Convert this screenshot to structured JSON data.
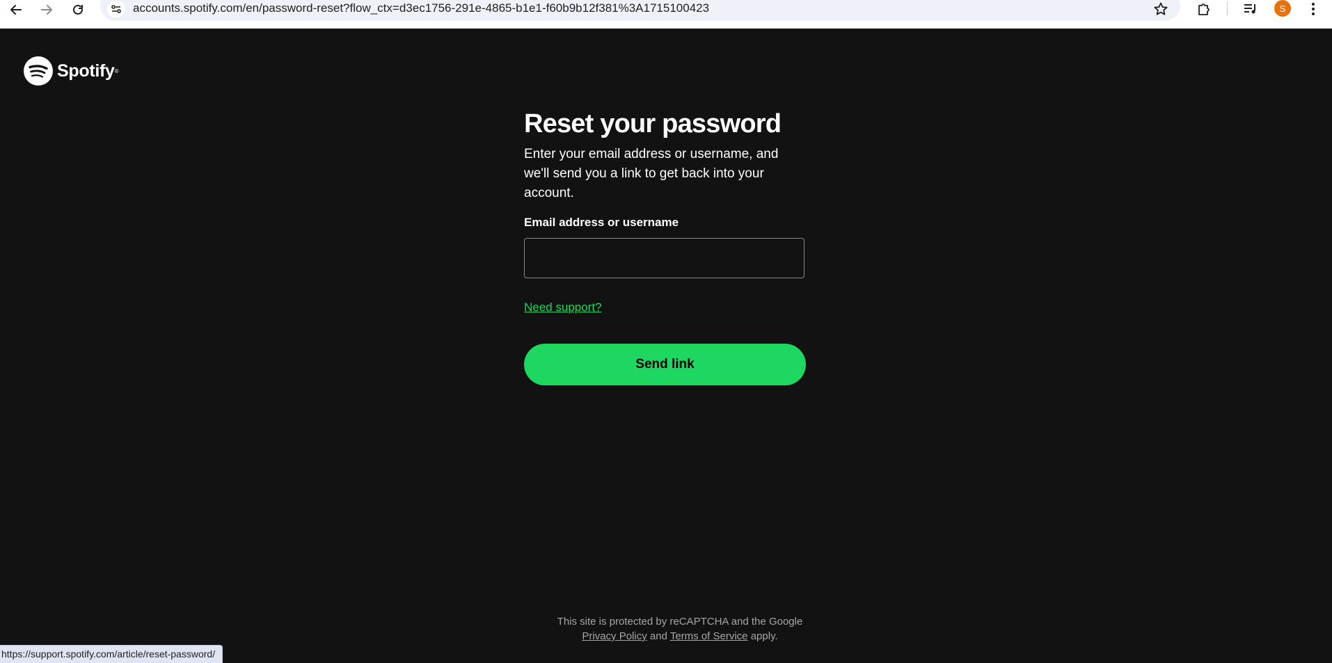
{
  "browser": {
    "url": "accounts.spotify.com/en/password-reset?flow_ctx=d3ec1756-291e-4865-b1e1-f60b9b12f381%3A1715100423",
    "avatar_letter": "S",
    "status_bar_url": "https://support.spotify.com/article/reset-password/",
    "icons": [
      "back-arrow-icon",
      "forward-arrow-icon",
      "reload-icon",
      "site-settings-icon",
      "bookmark-star-icon",
      "extensions-icon",
      "media-controls-icon",
      "more-vert-icon"
    ]
  },
  "brand": {
    "name": "Spotify",
    "color": "#1ed760"
  },
  "form": {
    "title": "Reset your password",
    "description": "Enter your email address or username, and we'll send you a link to get back into your account.",
    "field_label": "Email address or username",
    "field_value": "",
    "support_link": "Need support?",
    "submit_label": "Send link"
  },
  "footer": {
    "line1": "This site is protected by reCAPTCHA and the Google",
    "privacy_link": "Privacy Policy",
    "and_text": "and",
    "terms_link": "Terms of Service",
    "apply_text": "apply."
  }
}
